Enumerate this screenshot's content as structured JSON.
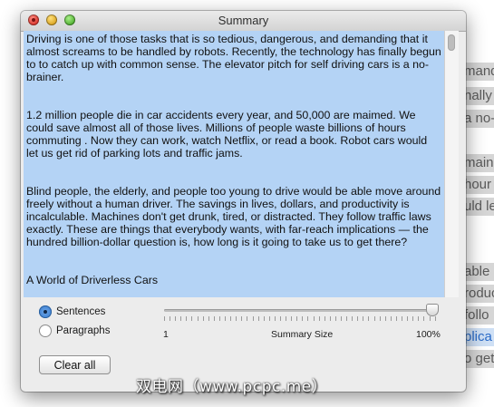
{
  "background_doc": {
    "lines": [
      {
        "text": "mand",
        "selected": false
      },
      {
        "text": "nally",
        "selected": false
      },
      {
        "text": "a no-",
        "selected": false
      },
      {
        "text": "main",
        "selected": false
      },
      {
        "text": "hour",
        "selected": false
      },
      {
        "text": "uld le",
        "selected": false
      },
      {
        "text": "able",
        "selected": false
      },
      {
        "text": "roduc",
        "selected": false
      },
      {
        "text": "follo",
        "selected": false
      },
      {
        "text": "plica",
        "selected": true
      },
      {
        "text": "o get",
        "selected": false
      }
    ]
  },
  "window": {
    "title": "Summary"
  },
  "summary": {
    "paragraphs": [
      "Driving is one of those tasks that is so tedious, dangerous, and demanding that it almost screams to be handled by robots.    Recently, the technology has finally begun to to catch up with common sense.    The elevator pitch for self driving cars is a no-brainer.",
      "1.2 million people die in car accidents every year, and 50,000 are maimed.    We could save almost all of those lives.    Millions of people waste billions of hours commuting .   Now they can work, watch Netflix, or read a book.   Robot cars would let us get rid of parking lots and traffic jams.",
      "Blind people, the elderly, and people too young to drive would be able move around freely without a human driver.   The savings in lives, dollars, and productivity is incalculable.    Machines don't get drunk, tired, or distracted.    They follow traffic laws exactly.    These are things that everybody wants, with far-reach implications — the hundred billion-dollar question is, how long is it going to take us to get there?",
      "A World of Driverless Cars"
    ]
  },
  "mode": {
    "options": [
      {
        "label": "Sentences",
        "selected": true
      },
      {
        "label": "Paragraphs",
        "selected": false
      }
    ]
  },
  "slider": {
    "min_label": "1",
    "label": "Summary Size",
    "max_label": "100%",
    "value_percent": 100
  },
  "actions": {
    "clear_label": "Clear all"
  },
  "watermark": "双电网（www.pcpc.me）"
}
